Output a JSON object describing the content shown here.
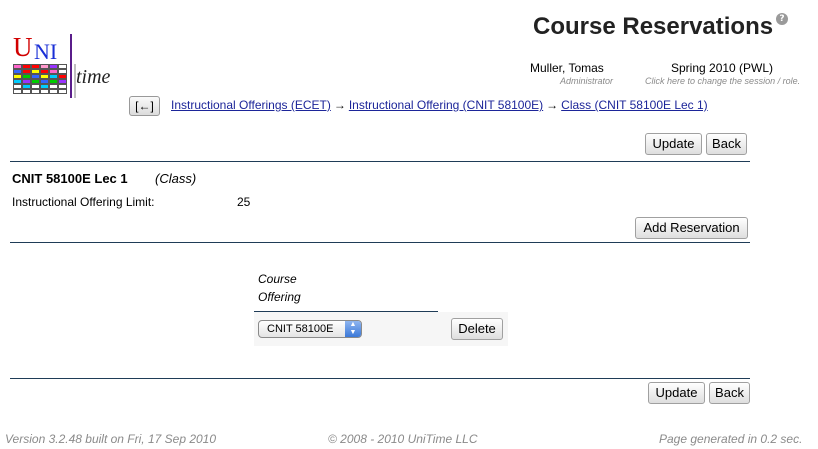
{
  "header": {
    "title": "Course Reservations",
    "help_icon": "?",
    "logo_u": "U",
    "logo_ni": "NI",
    "logo_time": "time"
  },
  "user": {
    "name": "Muller, Tomas",
    "role": "Administrator"
  },
  "session": {
    "name": "Spring 2010 (PWL)",
    "hint": "Click here to change the session / role."
  },
  "nav": {
    "back_label": "[←]",
    "breadcrumbs": [
      "Instructional Offerings (ECET)",
      "Instructional Offering (CNIT 58100E)",
      "Class (CNIT 58100E Lec 1)"
    ],
    "separator": "→"
  },
  "actions": {
    "update_label": "Update",
    "back_label": "Back",
    "add_reservation_label": "Add Reservation",
    "delete_label": "Delete"
  },
  "class_info": {
    "title": "CNIT 58100E Lec 1",
    "type": "(Class)",
    "limit_label": "Instructional Offering Limit:",
    "limit_value": "25"
  },
  "reservations": {
    "column_header_line1": "Course",
    "column_header_line2": "Offering",
    "selected_offering": "CNIT 58100E"
  },
  "footer": {
    "version": "Version 3.2.48 built on Fri, 17 Sep 2010",
    "copyright": "© 2008 - 2010 UniTime LLC",
    "generated": "Page generated in 0.2 sec."
  },
  "colors": {
    "link": "#1c2599",
    "divider": "#1f3c57",
    "logo_red": "#d10000",
    "logo_blue": "#1a2fd6",
    "muted": "#8a8a8a"
  }
}
